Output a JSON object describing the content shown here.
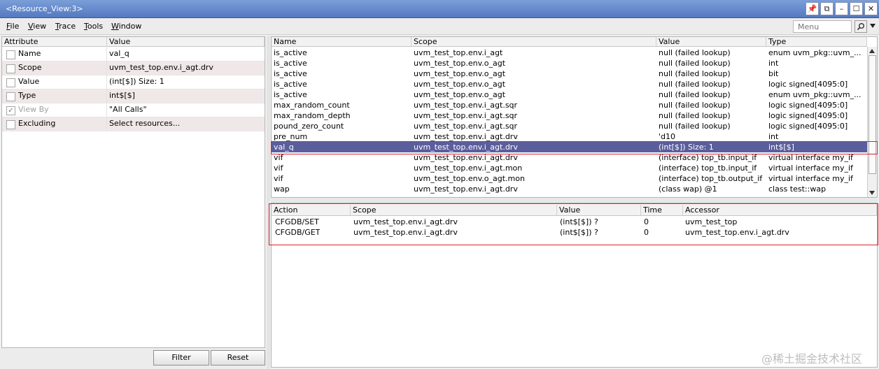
{
  "window": {
    "title": "<Resource_View:3>",
    "controls": {
      "pin": "📌",
      "float": "⧉",
      "minimize": "–",
      "maximize": "☐",
      "close": "✕"
    }
  },
  "menubar": {
    "items": [
      {
        "first": "F",
        "rest": "ile"
      },
      {
        "first": "V",
        "rest": "iew"
      },
      {
        "first": "T",
        "rest": "race"
      },
      {
        "first": "T",
        "rest": "ools"
      },
      {
        "first": "W",
        "rest": "indow"
      }
    ],
    "search_placeholder": "Menu"
  },
  "attributes": {
    "headers": {
      "attribute": "Attribute",
      "value": "Value"
    },
    "rows": [
      {
        "name": "Name",
        "value": "val_q",
        "checked": false,
        "disabled": false
      },
      {
        "name": "Scope",
        "value": "uvm_test_top.env.i_agt.drv",
        "checked": false,
        "disabled": false
      },
      {
        "name": "Value",
        "value": "(int[$]) Size: 1",
        "checked": false,
        "disabled": false
      },
      {
        "name": "Type",
        "value": "int$[$]",
        "checked": false,
        "disabled": false
      },
      {
        "name": "View By",
        "value": "\"All Calls\"",
        "checked": true,
        "disabled": true
      },
      {
        "name": "Excluding",
        "value": "Select resources...",
        "checked": false,
        "disabled": false
      }
    ],
    "filter_label": "Filter",
    "reset_label": "Reset"
  },
  "resources": {
    "headers": {
      "name": "Name",
      "scope": "Scope",
      "value": "Value",
      "type": "Type"
    },
    "rows": [
      {
        "name": "is_active",
        "scope": "uvm_test_top.env.i_agt",
        "value": "null (failed lookup)",
        "type": "enum uvm_pkg::uvm_..."
      },
      {
        "name": "is_active",
        "scope": "uvm_test_top.env.o_agt",
        "value": "null (failed lookup)",
        "type": "int"
      },
      {
        "name": "is_active",
        "scope": "uvm_test_top.env.o_agt",
        "value": "null (failed lookup)",
        "type": "bit"
      },
      {
        "name": "is_active",
        "scope": "uvm_test_top.env.o_agt",
        "value": "null (failed lookup)",
        "type": "logic signed[4095:0]"
      },
      {
        "name": "is_active",
        "scope": "uvm_test_top.env.o_agt",
        "value": "null (failed lookup)",
        "type": "enum uvm_pkg::uvm_..."
      },
      {
        "name": "max_random_count",
        "scope": "uvm_test_top.env.i_agt.sqr",
        "value": "null (failed lookup)",
        "type": "logic signed[4095:0]"
      },
      {
        "name": "max_random_depth",
        "scope": "uvm_test_top.env.i_agt.sqr",
        "value": "null (failed lookup)",
        "type": "logic signed[4095:0]"
      },
      {
        "name": "pound_zero_count",
        "scope": "uvm_test_top.env.i_agt.sqr",
        "value": "null (failed lookup)",
        "type": "logic signed[4095:0]"
      },
      {
        "name": "pre_num",
        "scope": "uvm_test_top.env.i_agt.drv",
        "value": "'d10",
        "type": "int"
      },
      {
        "name": "val_q",
        "scope": "uvm_test_top.env.i_agt.drv",
        "value": "(int[$]) Size: 1",
        "type": "int$[$]",
        "selected": true
      },
      {
        "name": "vif",
        "scope": "uvm_test_top.env.i_agt.drv",
        "value": "(interface) top_tb.input_if",
        "type": "virtual interface my_if"
      },
      {
        "name": "vif",
        "scope": "uvm_test_top.env.i_agt.mon",
        "value": "(interface) top_tb.input_if",
        "type": "virtual interface my_if"
      },
      {
        "name": "vif",
        "scope": "uvm_test_top.env.o_agt.mon",
        "value": "(interface) top_tb.output_if",
        "type": "virtual interface my_if"
      },
      {
        "name": "wap",
        "scope": "uvm_test_top.env.i_agt.drv",
        "value": "(class wap) @1",
        "type": "class test::wap"
      }
    ]
  },
  "access_log": {
    "headers": {
      "action": "Action",
      "scope": "Scope",
      "value": "Value",
      "time": "Time",
      "accessor": "Accessor"
    },
    "rows": [
      {
        "action": "CFGDB/SET",
        "scope": "uvm_test_top.env.i_agt.drv",
        "value": "(int$[$]) ?",
        "time": "0",
        "accessor": "uvm_test_top"
      },
      {
        "action": "CFGDB/GET",
        "scope": "uvm_test_top.env.i_agt.drv",
        "value": "(int$[$]) ?",
        "time": "0",
        "accessor": "uvm_test_top.env.i_agt.drv"
      }
    ]
  },
  "watermark": "@稀土掘金技术社区",
  "colors": {
    "titlebar": "#6a8fd0",
    "selection": "#5b5e9c",
    "highlight_box": "#e0202a",
    "alt_row": "#f0e8e8"
  }
}
